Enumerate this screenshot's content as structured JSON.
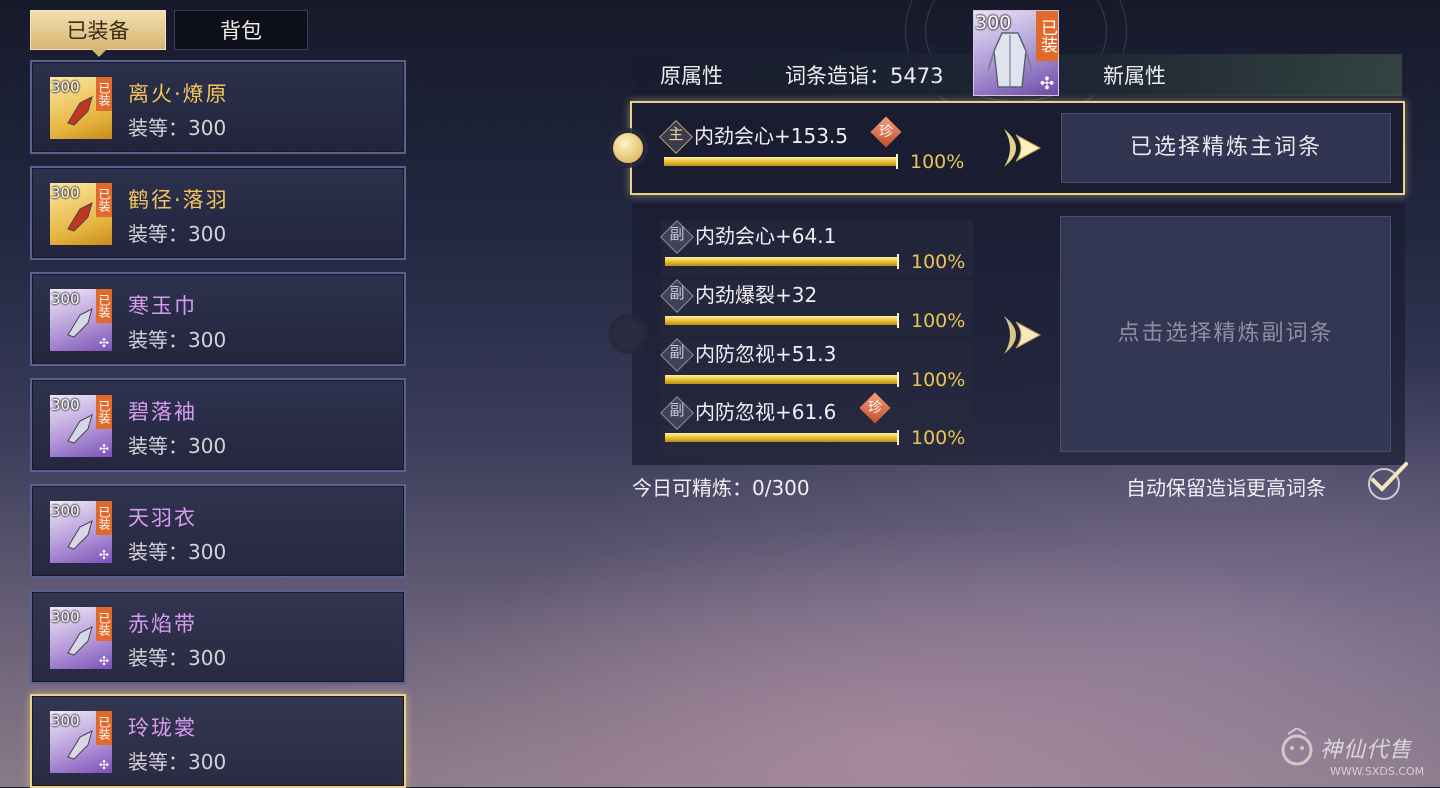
{
  "tabs": {
    "equipped": "已装备",
    "bag": "背包"
  },
  "equip_list": [
    {
      "name": "离火·燎原",
      "level_label": "装等：300",
      "icon_level": "300",
      "badge": "已装",
      "rarity": "gold"
    },
    {
      "name": "鹤径·落羽",
      "level_label": "装等：300",
      "icon_level": "300",
      "badge": "已装",
      "rarity": "gold"
    },
    {
      "name": "寒玉巾",
      "level_label": "装等：300",
      "icon_level": "300",
      "badge": "已装",
      "rarity": "purple"
    },
    {
      "name": "碧落袖",
      "level_label": "装等：300",
      "icon_level": "300",
      "badge": "已装",
      "rarity": "purple"
    },
    {
      "name": "天羽衣",
      "level_label": "装等：300",
      "icon_level": "300",
      "badge": "已装",
      "rarity": "purple"
    },
    {
      "name": "赤焰带",
      "level_label": "装等：300",
      "icon_level": "300",
      "badge": "已装",
      "rarity": "purple"
    },
    {
      "name": "玲珑裳",
      "level_label": "装等：300",
      "icon_level": "300",
      "badge": "已装",
      "rarity": "purple",
      "selected": true
    }
  ],
  "header": {
    "original_attrs": "原属性",
    "craft_label": "词条造诣：5473",
    "new_attrs": "新属性",
    "item_level": "300",
    "item_badge": "已装"
  },
  "main_attr": {
    "tag": "主",
    "text": "内劲会心+153.5",
    "rare_tag": "珍",
    "progress": 100,
    "percent_label": "100%"
  },
  "main_choice_label": "已选择精炼主词条",
  "sub_attrs": [
    {
      "tag": "副",
      "text": "内劲会心+64.1",
      "progress": 100,
      "percent_label": "100%"
    },
    {
      "tag": "副",
      "text": "内劲爆裂+32",
      "progress": 100,
      "percent_label": "100%"
    },
    {
      "tag": "副",
      "text": "内防忽视+51.3",
      "progress": 100,
      "percent_label": "100%"
    },
    {
      "tag": "副",
      "text": "内防忽视+61.6",
      "rare_tag": "珍",
      "progress": 100,
      "percent_label": "100%"
    }
  ],
  "sub_choice_label": "点击选择精炼副词条",
  "daily_label": "今日可精炼：0/300",
  "auto_keep_label": "自动保留造诣更高词条",
  "watermark": {
    "text": "神仙代售",
    "url": "WWW.SXDS.COM"
  },
  "colors": {
    "gold_accent": "#e9d38a",
    "gold_name": "#f2c65a",
    "purple_name": "#d79cf0",
    "progress": "#e9c23a"
  }
}
